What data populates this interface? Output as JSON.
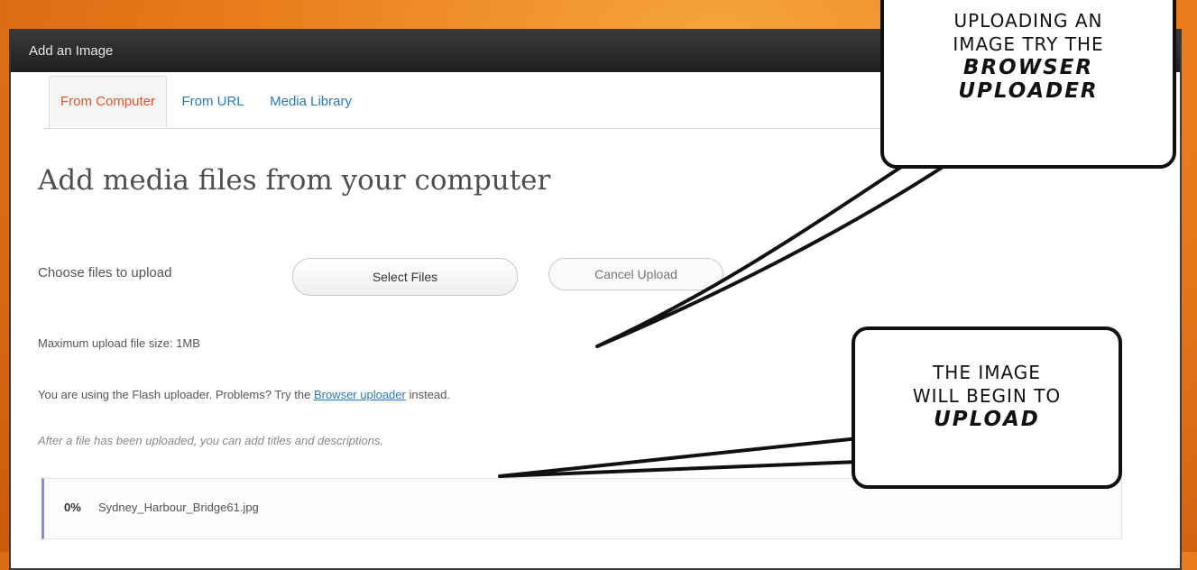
{
  "dialog": {
    "title": "Add an Image",
    "tabs": [
      {
        "label": "From Computer",
        "active": true
      },
      {
        "label": "From URL",
        "active": false
      },
      {
        "label": "Media Library",
        "active": false
      }
    ],
    "heading": "Add media files from your computer",
    "choose_label": "Choose files to upload",
    "select_button": "Select Files",
    "cancel_button": "Cancel Upload",
    "max_size": "Maximum upload file size: 1MB",
    "flash_prefix": "You are using the Flash uploader. Problems? Try the",
    "flash_link": "Browser uploader",
    "flash_suffix": "instead.",
    "after_text": "After a file has been uploaded, you can add titles and descriptions.",
    "upload_item": {
      "percent": "0%",
      "filename": "Sydney_Harbour_Bridge61.jpg"
    }
  },
  "callouts": {
    "top": {
      "lines": [
        "uploading an",
        "image try the"
      ],
      "emphasis": [
        "Browser",
        "uploader"
      ]
    },
    "bottom": {
      "lines": [
        "The image",
        "will begin to"
      ],
      "emphasis": [
        "upload"
      ]
    }
  },
  "colors": {
    "background": "#ea7d1c",
    "active_tab": "#d8572b",
    "link": "#2a7ab8"
  }
}
